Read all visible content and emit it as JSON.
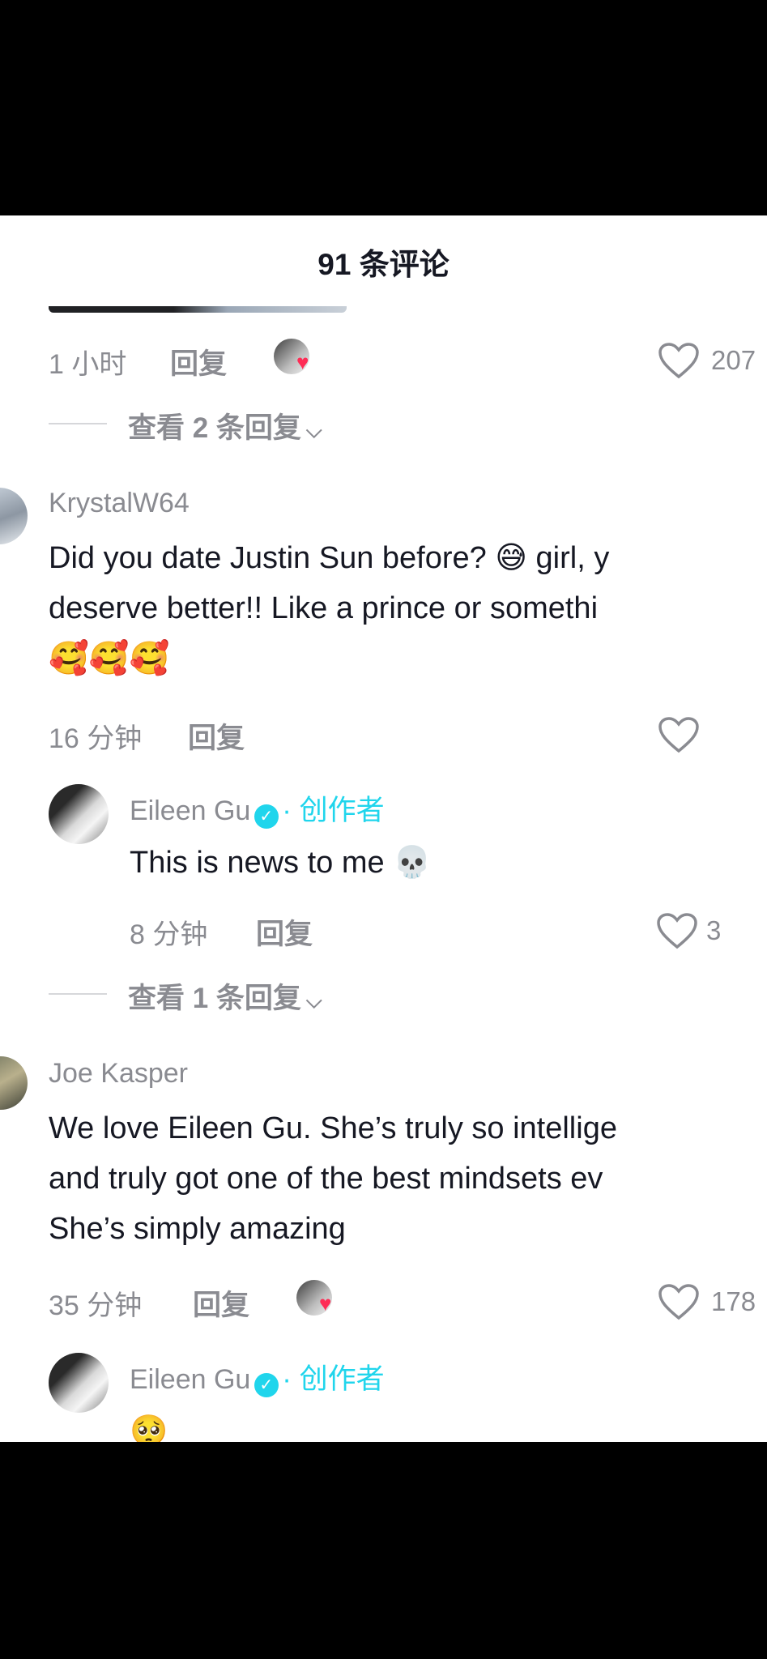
{
  "header": {
    "title": "91 条评论"
  },
  "comment0": {
    "time": "1 小时",
    "reply_label": "回复",
    "likes": "207",
    "view_replies": "查看 2 条回复"
  },
  "comment1": {
    "username": "KrystalW64",
    "lines": [
      "Did you date Justin Sun before? 😅 girl, y",
      "deserve better!! Like a prince or somethi",
      "🥰🥰🥰"
    ],
    "time": "16 分钟",
    "reply_label": "回复",
    "reply": {
      "username": "Eileen Gu",
      "creator_label": "· 创作者",
      "text": "This is news to me 💀",
      "time": "8 分钟",
      "reply_label": "回复",
      "likes": "3"
    },
    "view_replies": "查看 1 条回复"
  },
  "comment2": {
    "username": "Joe Kasper",
    "lines": [
      "We love Eileen Gu. She’s truly so intellige",
      "and truly got one of the best mindsets ev",
      "She’s simply amazing"
    ],
    "time": "35 分钟",
    "reply_label": "回复",
    "likes": "178",
    "reply": {
      "username": "Eileen Gu",
      "creator_label": "· 创作者",
      "text": "🥺"
    }
  },
  "icons": {
    "heart": "heart-outline-icon",
    "chevron": "chevron-down-icon",
    "verified": "verified-badge-icon",
    "liked_by_creator": "creator-liked-heart-icon"
  },
  "colors": {
    "accent": "#20d5ec",
    "heart": "#fe2c55",
    "text": "#161823",
    "muted": "#8a8b91"
  }
}
